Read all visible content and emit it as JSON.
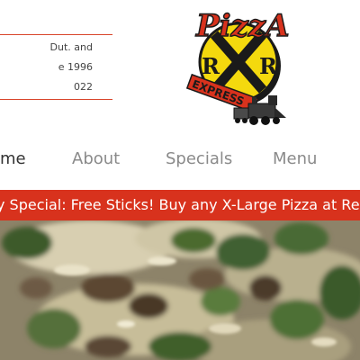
{
  "header": {
    "info_lines": [
      "Dut. and",
      "e 1996",
      "022"
    ]
  },
  "logo": {
    "word": "PizzA",
    "letter_left": "R",
    "letter_right": "R",
    "ribbon": "EXPRESS",
    "colors": {
      "sign_yellow": "#f4d90e",
      "sign_red": "#d8321d",
      "outline": "#1a1a1a"
    }
  },
  "nav": {
    "items": [
      {
        "label": "me",
        "active": true
      },
      {
        "label": "About",
        "active": false
      },
      {
        "label": "Specials",
        "active": false
      },
      {
        "label": "Menu",
        "active": false
      }
    ]
  },
  "banner": {
    "text": "y Special: Free Sticks! Buy any X-Large Pizza at Regular Pr",
    "color": "#d8321d"
  },
  "hero": {
    "alt": "pizza-closeup-image"
  }
}
